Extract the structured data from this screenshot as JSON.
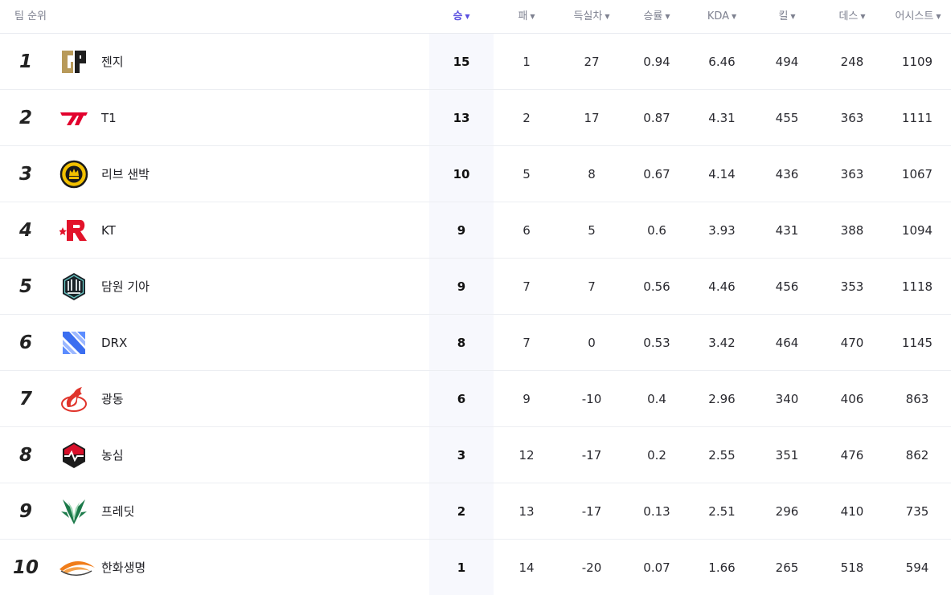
{
  "header": {
    "team_rank": "팀 순위",
    "columns": [
      "승",
      "패",
      "득실차",
      "승률",
      "KDA",
      "킬",
      "데스",
      "어시스트"
    ]
  },
  "colors": {
    "accent": "#5a4fe0",
    "highlight_column": "#f7f8fd"
  },
  "rows": [
    {
      "rank": "1",
      "team": "젠지",
      "logo": "geng-logo-icon",
      "win": "15",
      "loss": "1",
      "diff": "27",
      "rate": "0.94",
      "kda": "6.46",
      "kill": "494",
      "death": "248",
      "assist": "1109"
    },
    {
      "rank": "2",
      "team": "T1",
      "logo": "t1-logo-icon",
      "win": "13",
      "loss": "2",
      "diff": "17",
      "rate": "0.87",
      "kda": "4.31",
      "kill": "455",
      "death": "363",
      "assist": "1111"
    },
    {
      "rank": "3",
      "team": "리브 샌박",
      "logo": "liiv-sandbox-logo-icon",
      "win": "10",
      "loss": "5",
      "diff": "8",
      "rate": "0.67",
      "kda": "4.14",
      "kill": "436",
      "death": "363",
      "assist": "1067"
    },
    {
      "rank": "4",
      "team": "KT",
      "logo": "kt-logo-icon",
      "win": "9",
      "loss": "6",
      "diff": "5",
      "rate": "0.6",
      "kda": "3.93",
      "kill": "431",
      "death": "388",
      "assist": "1094"
    },
    {
      "rank": "5",
      "team": "담원 기아",
      "logo": "dwg-kia-logo-icon",
      "win": "9",
      "loss": "7",
      "diff": "7",
      "rate": "0.56",
      "kda": "4.46",
      "kill": "456",
      "death": "353",
      "assist": "1118"
    },
    {
      "rank": "6",
      "team": "DRX",
      "logo": "drx-logo-icon",
      "win": "8",
      "loss": "7",
      "diff": "0",
      "rate": "0.53",
      "kda": "3.42",
      "kill": "464",
      "death": "470",
      "assist": "1145"
    },
    {
      "rank": "7",
      "team": "광동",
      "logo": "kwangdong-logo-icon",
      "win": "6",
      "loss": "9",
      "diff": "-10",
      "rate": "0.4",
      "kda": "2.96",
      "kill": "340",
      "death": "406",
      "assist": "863"
    },
    {
      "rank": "8",
      "team": "농심",
      "logo": "nongshim-logo-icon",
      "win": "3",
      "loss": "12",
      "diff": "-17",
      "rate": "0.2",
      "kda": "2.55",
      "kill": "351",
      "death": "476",
      "assist": "862"
    },
    {
      "rank": "9",
      "team": "프레딧",
      "logo": "fredit-logo-icon",
      "win": "2",
      "loss": "13",
      "diff": "-17",
      "rate": "0.13",
      "kda": "2.51",
      "kill": "296",
      "death": "410",
      "assist": "735"
    },
    {
      "rank": "10",
      "team": "한화생명",
      "logo": "hanwha-logo-icon",
      "win": "1",
      "loss": "14",
      "diff": "-20",
      "rate": "0.07",
      "kda": "1.66",
      "kill": "265",
      "death": "518",
      "assist": "594"
    }
  ]
}
